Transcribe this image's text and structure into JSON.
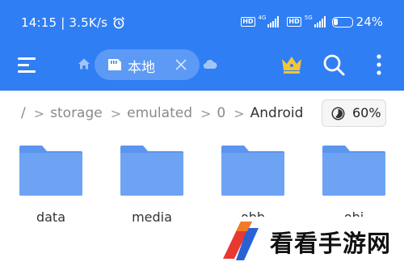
{
  "status_bar": {
    "time_speed": "14:15 | 3.5K/s",
    "sim1_hd": "HD",
    "sim1_gen": "4G",
    "sim2_hd": "HD",
    "sim2_gen": "5G",
    "battery": "24%"
  },
  "toolbar": {
    "tab_label": "本地"
  },
  "breadcrumb": {
    "root": "/",
    "items": [
      "storage",
      "emulated",
      "0",
      "Android"
    ]
  },
  "storage": {
    "used": "60%",
    "fraction": 0.6
  },
  "folders": [
    {
      "name": "data"
    },
    {
      "name": "media"
    },
    {
      "name": "obb"
    },
    {
      "name": "obj"
    }
  ],
  "watermark": {
    "text": "看看手游网"
  },
  "colors": {
    "accent": "#2f7ef4",
    "folder": "#6ea3f3",
    "folder_tab": "#5b95ee"
  }
}
